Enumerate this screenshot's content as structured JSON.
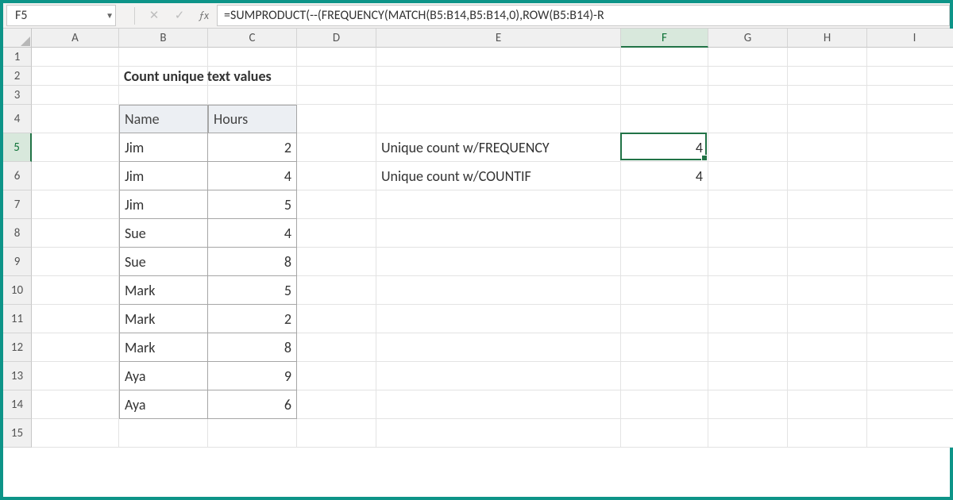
{
  "name_box": "F5",
  "formula": "=SUMPRODUCT(--(FREQUENCY(MATCH(B5:B14,B5:B14,0),ROW(B5:B14)-R",
  "columns": [
    "A",
    "B",
    "C",
    "D",
    "E",
    "F",
    "G",
    "H",
    "I"
  ],
  "active_col": "F",
  "active_row": 5,
  "row_labels": [
    "1",
    "2",
    "3",
    "4",
    "5",
    "6",
    "7",
    "8",
    "9",
    "10",
    "11",
    "12",
    "13",
    "14",
    "15"
  ],
  "title": "Count unique text values",
  "table": {
    "headers": [
      "Name",
      "Hours"
    ],
    "rows": [
      [
        "Jim",
        "2"
      ],
      [
        "Jim",
        "4"
      ],
      [
        "Jim",
        "5"
      ],
      [
        "Sue",
        "4"
      ],
      [
        "Sue",
        "8"
      ],
      [
        "Mark",
        "5"
      ],
      [
        "Mark",
        "2"
      ],
      [
        "Mark",
        "8"
      ],
      [
        "Aya",
        "9"
      ],
      [
        "Aya",
        "6"
      ]
    ]
  },
  "results": [
    {
      "label": "Unique count w/FREQUENCY",
      "value": "4"
    },
    {
      "label": "Unique count w/COUNTIF",
      "value": "4"
    }
  ]
}
